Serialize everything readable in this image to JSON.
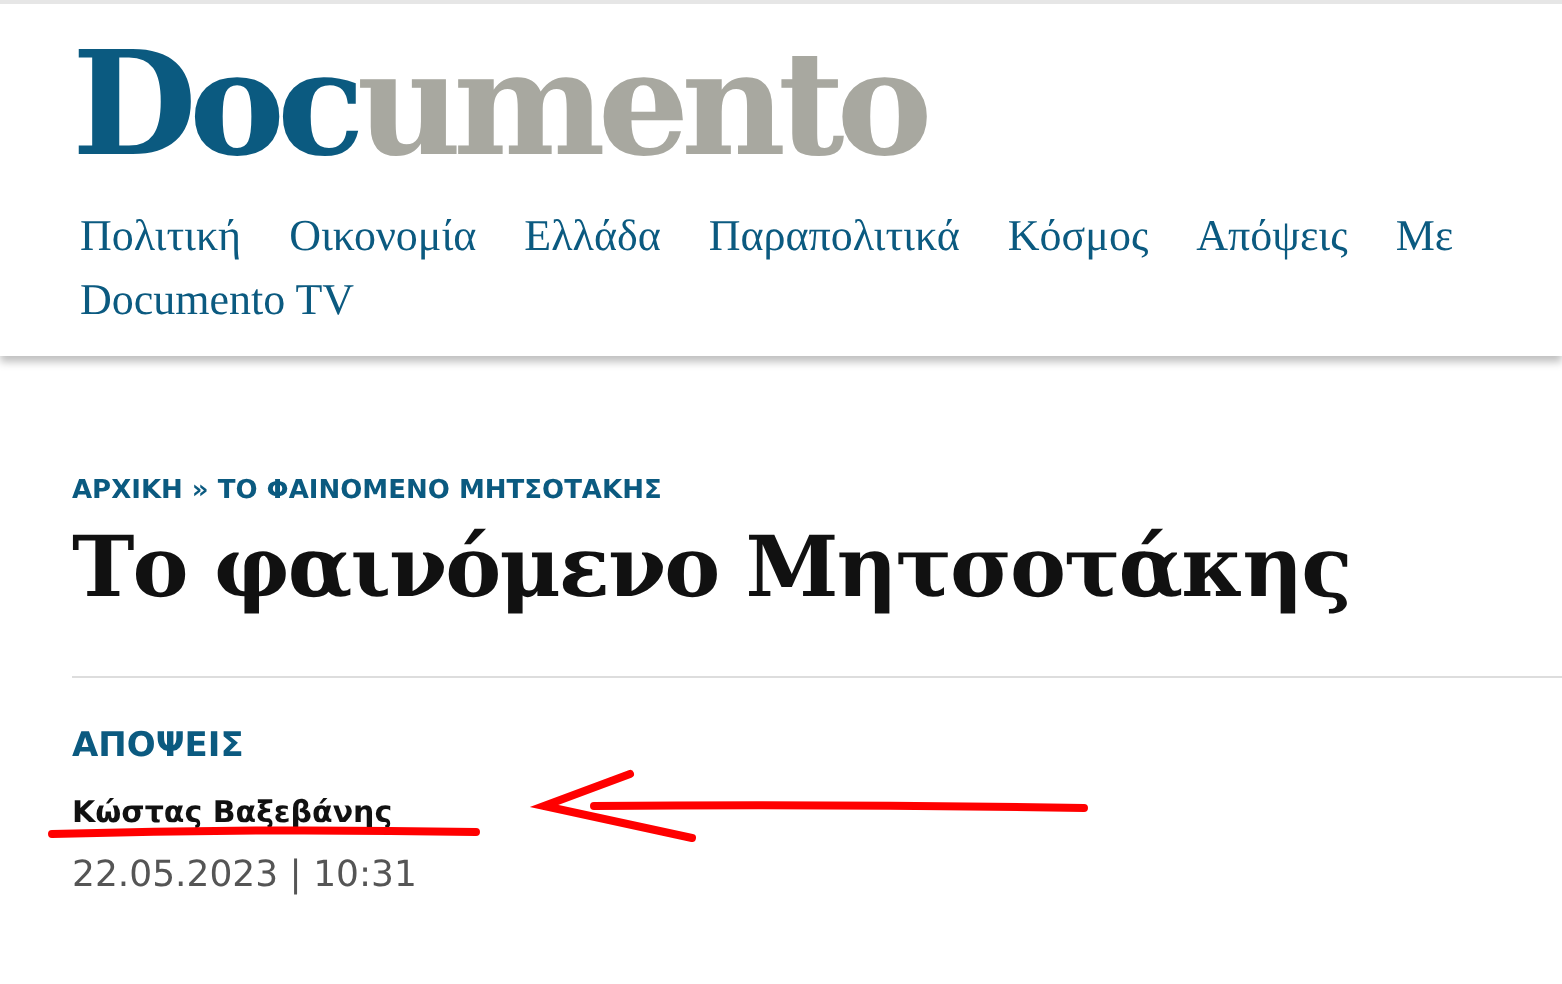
{
  "header": {
    "logo": {
      "parts": [
        {
          "text": "Doc",
          "color": "#0b5a80"
        },
        {
          "text": "umento",
          "color": "#a8a8a0"
        }
      ]
    },
    "nav_rows": [
      [
        "Πολιτική",
        "Οικονομία",
        "Ελλάδα",
        "Παραπολιτικά",
        "Κόσμος",
        "Απόψεις",
        "Με"
      ],
      [
        "Documento TV"
      ]
    ]
  },
  "article": {
    "breadcrumb": "ΑΡΧΙΚΗ » ΤΟ ΦΑΙΝΟΜΕΝΟ ΜΗΤΣΟΤΑΚΗΣ",
    "title": "Το φαινόμενο Μητσοτάκης",
    "category": "ΑΠΟΨΕΙΣ",
    "author": "Κώστας Βαξεβάνης",
    "date": "22.05.2023 | 10:31"
  }
}
